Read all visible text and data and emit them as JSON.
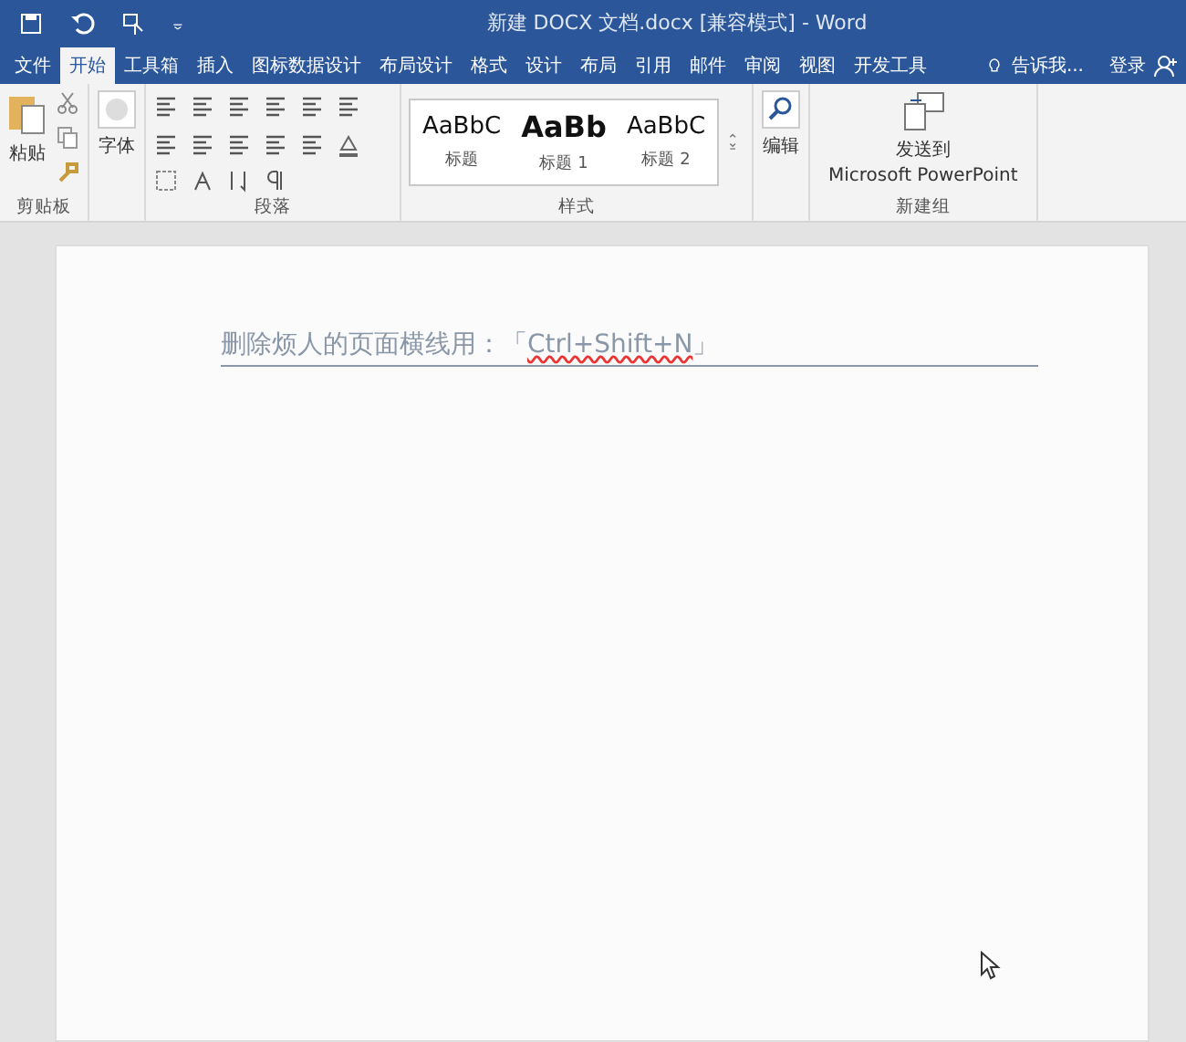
{
  "window": {
    "title": "新建 DOCX 文档.docx [兼容模式] - Word"
  },
  "tabs": [
    {
      "label": "文件",
      "selected": false
    },
    {
      "label": "开始",
      "selected": true
    },
    {
      "label": "工具箱",
      "selected": false
    },
    {
      "label": "插入",
      "selected": false
    },
    {
      "label": "图标数据设计",
      "selected": false
    },
    {
      "label": "布局设计",
      "selected": false
    },
    {
      "label": "格式",
      "selected": false
    },
    {
      "label": "设计",
      "selected": false
    },
    {
      "label": "布局",
      "selected": false
    },
    {
      "label": "引用",
      "selected": false
    },
    {
      "label": "邮件",
      "selected": false
    },
    {
      "label": "审阅",
      "selected": false
    },
    {
      "label": "视图",
      "selected": false
    },
    {
      "label": "开发工具",
      "selected": false
    }
  ],
  "tell_me": {
    "placeholder": "告诉我..."
  },
  "sign_in": "登录",
  "ribbon": {
    "clipboard": {
      "paste": "粘贴",
      "label": "剪贴板"
    },
    "font": {
      "button": "字体"
    },
    "paragraph": {
      "label": "段落"
    },
    "styles": {
      "label": "样式",
      "items": [
        {
          "preview": "AaBbC",
          "name": "标题",
          "kind": "normal"
        },
        {
          "preview": "AaBb",
          "name": "标题 1",
          "kind": "heading"
        },
        {
          "preview": "AaBbC",
          "name": "标题 2",
          "kind": "normal"
        }
      ]
    },
    "editing": {
      "button": "编辑"
    },
    "new_group": {
      "button_line_1": "发送到",
      "button_line_2": "Microsoft PowerPoint",
      "label": "新建组"
    }
  },
  "document": {
    "heading": "删除烦人的页面横线用：「",
    "shortcut": "Ctrl+Shift+N",
    "heading_end": "」"
  }
}
